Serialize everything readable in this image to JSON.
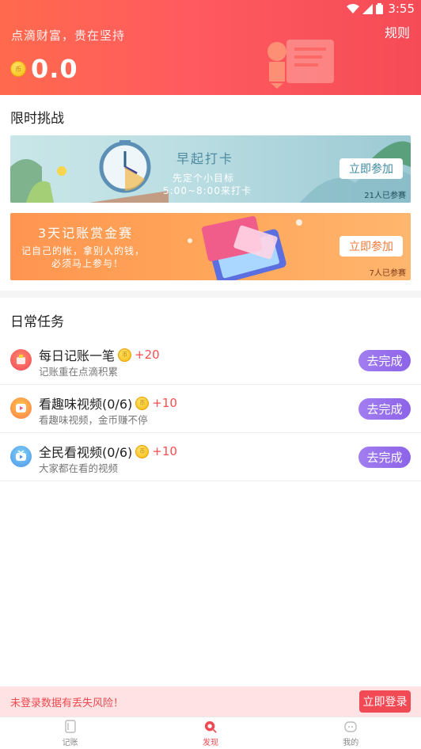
{
  "status_bar": {
    "time": "3:55"
  },
  "header": {
    "slogan": "点滴财富，贵在坚持",
    "rules_label": "规则",
    "balance": "0.0",
    "coin_symbol": "币"
  },
  "limited": {
    "title": "限时挑战",
    "banners": [
      {
        "title": "早起打卡",
        "subtitle_line1": "先定个小目标",
        "subtitle_line2": "5:00~8:00来打卡",
        "join_label": "立即参加",
        "participants": "21人已参赛"
      },
      {
        "title": "3天记账赏金赛",
        "subtitle_line1": "记自己的帐，拿别人的钱，",
        "subtitle_line2": "必须马上参与！",
        "join_label": "立即参加",
        "participants": "7人已参赛"
      }
    ]
  },
  "daily": {
    "title": "日常任务",
    "tasks": [
      {
        "name": "每日记账一笔",
        "reward": "+20",
        "desc": "记账重在点滴积累",
        "button": "去完成"
      },
      {
        "name": "看趣味视频(0/6)",
        "reward": "+10",
        "desc": "看趣味视频，金币赚不停",
        "button": "去完成"
      },
      {
        "name": "全民看视频(0/6)",
        "reward": "+10",
        "desc": "大家都在看的视频",
        "button": "去完成"
      }
    ]
  },
  "warning": {
    "text": "未登录数据有丢失风险！",
    "login_label": "立即登录"
  },
  "nav": {
    "items": [
      {
        "label": "记账"
      },
      {
        "label": "发现"
      },
      {
        "label": "我的"
      }
    ]
  },
  "colors": {
    "header_start": "#ff6a4d",
    "header_end": "#f54b57",
    "accent_red": "#f24a54",
    "button_purple": "#8d63e8"
  }
}
